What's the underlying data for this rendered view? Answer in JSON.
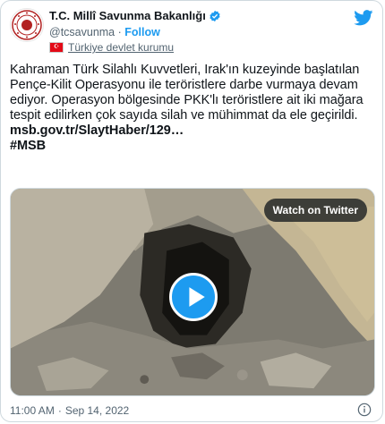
{
  "account": {
    "display_name": "T.C. Millî Savunma Bakanlığı",
    "handle": "@tcsavunma",
    "separator": "·",
    "follow_label": "Follow",
    "affiliation_label": "Türkiye devlet kurumu"
  },
  "tweet": {
    "text": "Kahraman Türk Silahlı Kuvvetleri, Irak'ın kuzeyinde başlatılan Pençe-Kilit Operasyonu ile teröristlere darbe vurmaya devam ediyor. Operasyon bölgesinde PKK'lı teröristlere ait iki mağara tespit edilirken çok sayıda silah ve mühimmat da ele geçirildi.",
    "link": "msb.gov.tr/SlaytHaber/129…",
    "hashtag": "#MSB"
  },
  "media": {
    "watch_label": "Watch on Twitter"
  },
  "meta": {
    "time": "11:00 AM",
    "separator": "·",
    "date": "Sep 14, 2022"
  },
  "colors": {
    "accent": "#1d9bf0",
    "text": "#0f1419",
    "muted": "#536471",
    "flag_red": "#e30a17"
  },
  "icons": [
    "msb-logo-icon",
    "verified-badge-icon",
    "turkey-flag-icon",
    "twitter-bird-icon",
    "play-icon",
    "info-icon"
  ]
}
